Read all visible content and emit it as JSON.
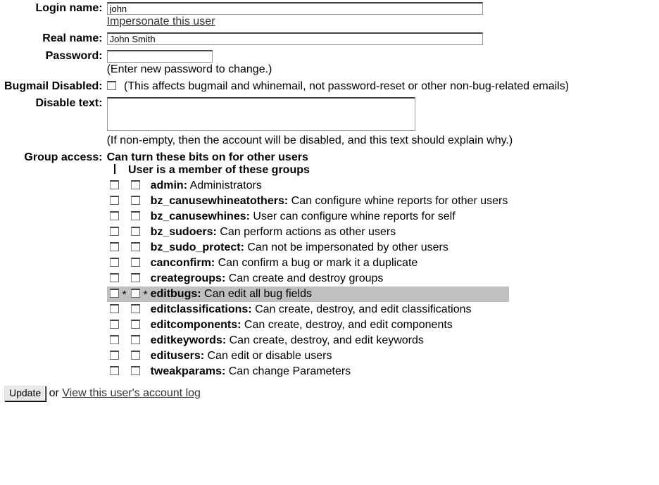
{
  "fields": {
    "login": {
      "label": "Login name:",
      "value": "john",
      "impersonate": "Impersonate this user"
    },
    "realname": {
      "label": "Real name:",
      "value": "John Smith"
    },
    "password": {
      "label": "Password:",
      "hint": "(Enter new password to change.)"
    },
    "bugmail": {
      "label": "Bugmail Disabled:",
      "hint": "(This affects bugmail and whinemail, not password-reset or other non-bug-related emails)"
    },
    "disabletext": {
      "label": "Disable text:",
      "hint": "(If non-empty, then the account will be disabled, and this text should explain why.)"
    },
    "groupaccess": {
      "label": "Group access:",
      "header1": "Can turn these bits on for other users",
      "header2": "User is a member of these groups"
    }
  },
  "groups": [
    {
      "name": "admin:",
      "desc": " Administrators",
      "hl": false,
      "s1": "",
      "s2": ""
    },
    {
      "name": "bz_canusewhineatothers:",
      "desc": " Can configure whine reports for other users",
      "hl": false,
      "s1": "",
      "s2": ""
    },
    {
      "name": "bz_canusewhines:",
      "desc": " User can configure whine reports for self",
      "hl": false,
      "s1": "",
      "s2": ""
    },
    {
      "name": "bz_sudoers:",
      "desc": " Can perform actions as other users",
      "hl": false,
      "s1": "",
      "s2": ""
    },
    {
      "name": "bz_sudo_protect:",
      "desc": " Can not be impersonated by other users",
      "hl": false,
      "s1": "",
      "s2": ""
    },
    {
      "name": "canconfirm:",
      "desc": " Can confirm a bug or mark it a duplicate",
      "hl": false,
      "s1": "",
      "s2": ""
    },
    {
      "name": "creategroups:",
      "desc": " Can create and destroy groups",
      "hl": false,
      "s1": "",
      "s2": ""
    },
    {
      "name": "editbugs:",
      "desc": " Can edit all bug fields",
      "hl": true,
      "s1": "*",
      "s2": "*"
    },
    {
      "name": "editclassifications:",
      "desc": " Can create, destroy, and edit classifications",
      "hl": false,
      "s1": "",
      "s2": ""
    },
    {
      "name": "editcomponents:",
      "desc": " Can create, destroy, and edit components",
      "hl": false,
      "s1": "",
      "s2": ""
    },
    {
      "name": "editkeywords:",
      "desc": " Can create, destroy, and edit keywords",
      "hl": false,
      "s1": "",
      "s2": ""
    },
    {
      "name": "editusers:",
      "desc": " Can edit or disable users",
      "hl": false,
      "s1": "",
      "s2": ""
    },
    {
      "name": "tweakparams:",
      "desc": " Can change Parameters",
      "hl": false,
      "s1": "",
      "s2": ""
    }
  ],
  "footer": {
    "update": "Update",
    "or": " or ",
    "loglink": "View this user's account log"
  }
}
